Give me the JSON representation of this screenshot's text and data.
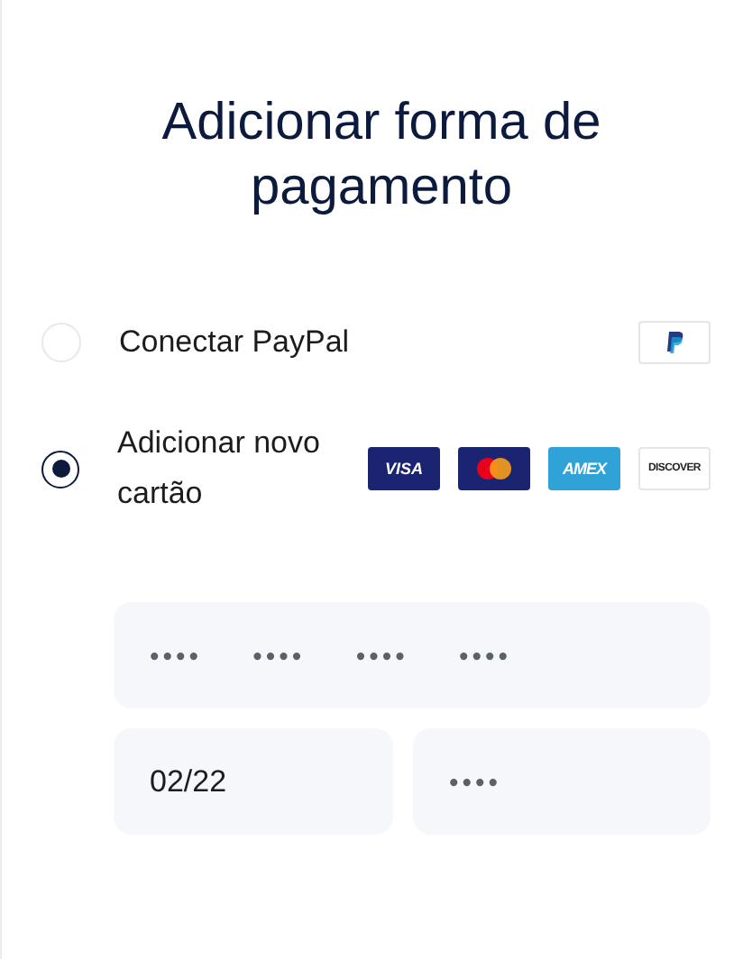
{
  "title": "Adicionar forma de pagamento",
  "options": [
    {
      "label": "Conectar PayPal",
      "selected": false,
      "logos": [
        {
          "kind": "paypal"
        }
      ]
    },
    {
      "label": "Adicionar novo cartão",
      "selected": true,
      "logos": [
        {
          "kind": "visa",
          "text": "VISA"
        },
        {
          "kind": "mastercard"
        },
        {
          "kind": "amex",
          "text": "AMEX"
        },
        {
          "kind": "discover",
          "text": "DISCOVER"
        }
      ]
    }
  ],
  "card_form": {
    "card_number": {
      "placeholder": "•••• •••• •••• ••••"
    },
    "expiry": {
      "value": "02/22"
    },
    "cvv": {
      "placeholder": "••••"
    }
  }
}
